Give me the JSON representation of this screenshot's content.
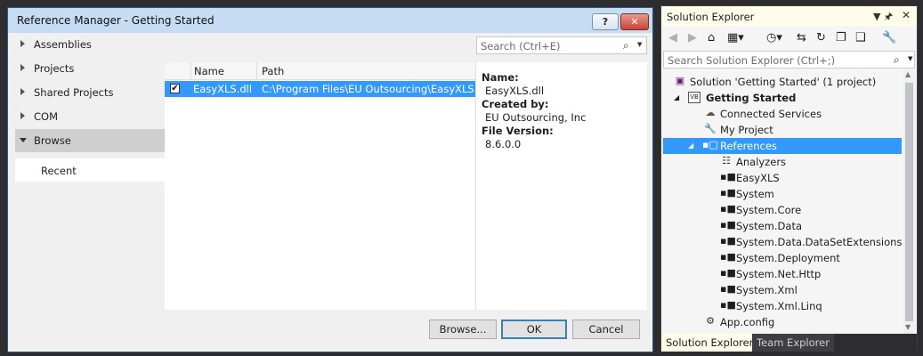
{
  "dialog": {
    "title": "Reference Manager - Getting Started",
    "help_label": "?",
    "close_label": "✕",
    "nav": [
      {
        "label": "Assemblies"
      },
      {
        "label": "Projects"
      },
      {
        "label": "Shared Projects"
      },
      {
        "label": "COM"
      },
      {
        "label": "Browse"
      }
    ],
    "nav_sub": "Recent",
    "search_placeholder": "Search (Ctrl+E)",
    "columns": {
      "name": "Name",
      "path": "Path"
    },
    "rows": [
      {
        "checked": true,
        "name": "EasyXLS.dll",
        "path": "C:\\Program Files\\EU Outsourcing\\EasyXLS..."
      }
    ],
    "info": {
      "name_label": "Name:",
      "name_value": "EasyXLS.dll",
      "created_label": "Created by:",
      "created_value": "EU Outsourcing, Inc",
      "version_label": "File Version:",
      "version_value": "8.6.0.0"
    },
    "buttons": {
      "browse": "Browse...",
      "ok": "OK",
      "cancel": "Cancel"
    }
  },
  "solution_explorer": {
    "title": "Solution Explorer",
    "pin_glyph": "▼ 📌",
    "close_glyph": "✕",
    "search_placeholder": "Search Solution Explorer (Ctrl+;)",
    "tree": {
      "solution": "Solution 'Getting Started' (1 project)",
      "project": "Getting Started",
      "connected_services": "Connected Services",
      "my_project": "My Project",
      "references": "References",
      "refs": [
        "Analyzers",
        "EasyXLS",
        "System",
        "System.Core",
        "System.Data",
        "System.Data.DataSetExtensions",
        "System.Deployment",
        "System.Net.Http",
        "System.Xml",
        "System.Xml.Linq"
      ],
      "app_config": "App.config"
    },
    "tabs": {
      "solution_explorer": "Solution Explorer",
      "team_explorer": "Team Explorer"
    }
  },
  "colors": {
    "selection": "#3399ff",
    "title_bar": "#c5dcf2",
    "dark_bg": "#2d2d30"
  }
}
